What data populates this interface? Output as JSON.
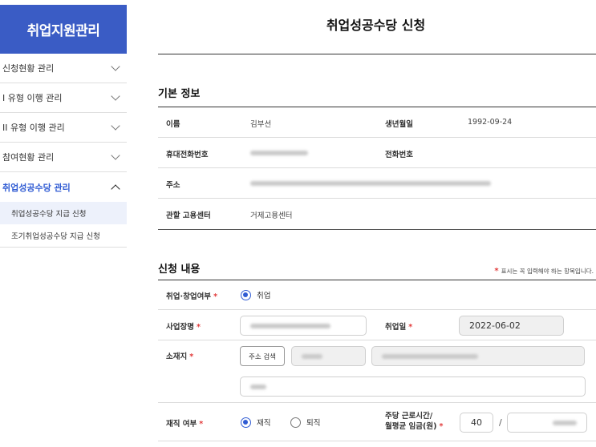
{
  "sidebar": {
    "title": "취업지원관리",
    "items": [
      {
        "label": "신청현황 관리"
      },
      {
        "label": "I 유형 이행 관리"
      },
      {
        "label": "II 유형 이행 관리"
      },
      {
        "label": "참여현황 관리"
      },
      {
        "label": "취업성공수당 관리"
      }
    ],
    "subitems": [
      {
        "label": "취업성공수당 지급 신청"
      },
      {
        "label": "조기취업성공수당 지급 신청"
      }
    ]
  },
  "page": {
    "title": "취업성공수당 신청"
  },
  "basic": {
    "title": "기본 정보",
    "name_label": "이름",
    "name_value": "김부선",
    "birth_label": "생년월일",
    "birth_value": "1992-09-24",
    "mobile_label": "휴대전화번호",
    "phone_label": "전화번호",
    "address_label": "주소",
    "center_label": "관할 고용센터",
    "center_value": "거제고용센터"
  },
  "apply": {
    "title": "신청 내용",
    "required_note": "표시는 꼭 입력해야 하는 항목입니다.",
    "required_star": "*",
    "emp_label": "취업·창업여부",
    "emp_option": "취업",
    "workplace_label": "사업장명",
    "hire_date_label": "취업일",
    "hire_date_value": "2022-06-02",
    "location_label": "소재지",
    "address_search_button": "주소 검색",
    "employment_status_label": "재직 여부",
    "status_options": [
      "재직",
      "퇴직"
    ],
    "hours_label_line1": "주당 근로시간/",
    "hours_label_line2": "월평균 임금(원)",
    "hours_value": "40",
    "slash": "/"
  },
  "colors": {
    "brand": "#3a5cc5",
    "accent": "#2f5bd3",
    "required": "#e23b3b"
  }
}
